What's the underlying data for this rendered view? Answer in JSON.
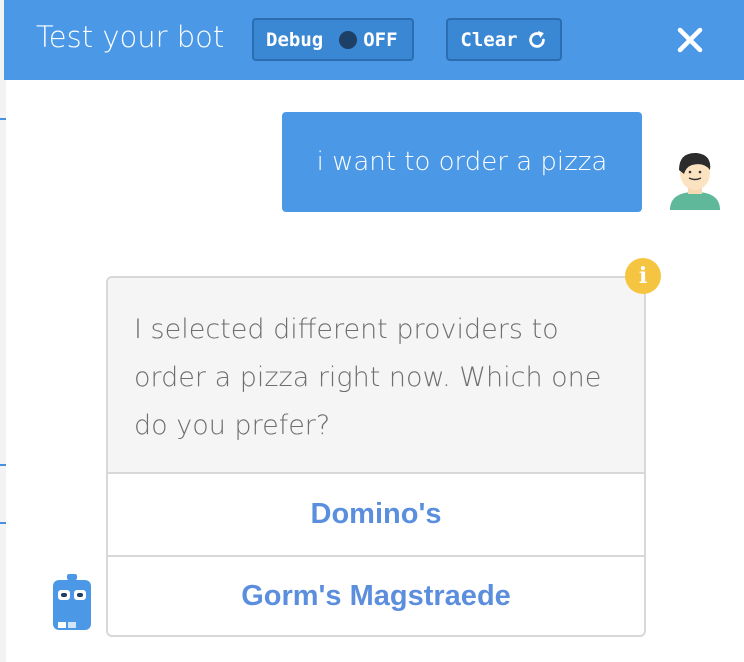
{
  "header": {
    "title": "Test your bot",
    "debug": {
      "label": "Debug",
      "state": "OFF"
    },
    "clear_label": "Clear",
    "close_icon": "close-icon",
    "refresh_icon": "refresh-icon"
  },
  "conversation": {
    "user_message": "i want to order a pizza",
    "bot_message": "I selected different providers to order a pizza right now. Which one do you prefer?",
    "options": [
      "Domino's",
      "Gorm's Magstraede"
    ],
    "info_symbol": "i"
  },
  "colors": {
    "header_bg": "#4a98e6",
    "user_bubble": "#4a98e6",
    "option_text": "#5b8fde",
    "info_badge": "#f5c542",
    "bot_avatar": "#4a98e6"
  }
}
